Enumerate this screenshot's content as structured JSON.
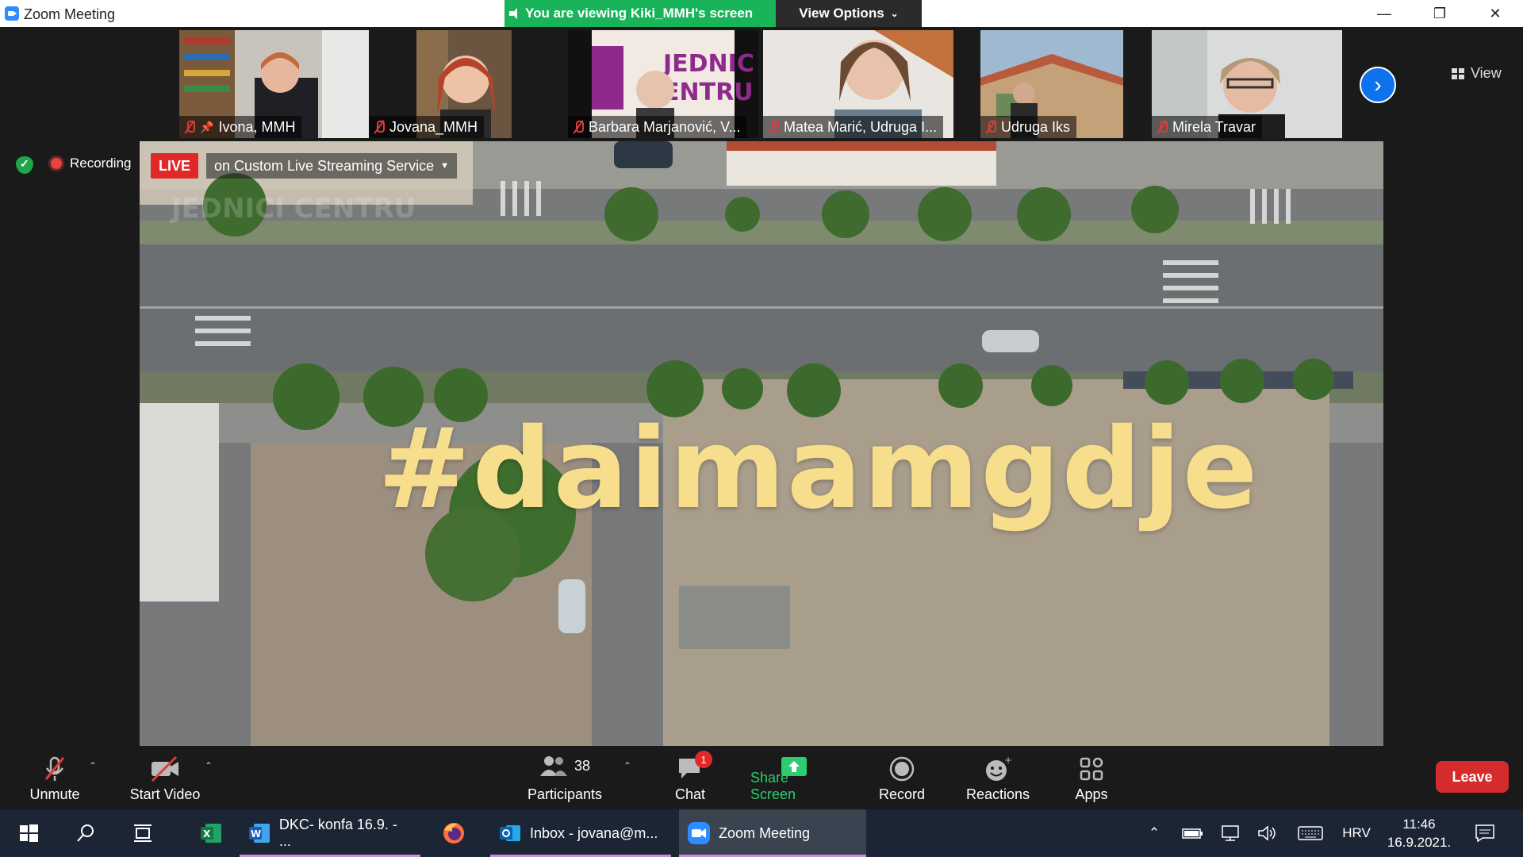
{
  "window": {
    "title": "Zoom Meeting",
    "viewing_banner": "You are viewing Kiki_MMH's screen",
    "view_options": "View Options",
    "view_label": "View"
  },
  "participants_strip": [
    {
      "name": "Ivona, MMH",
      "muted": true,
      "pinned": true,
      "active": true
    },
    {
      "name": "Jovana_MMH",
      "muted": true
    },
    {
      "name": "Barbara Marjanović, V...",
      "muted": true
    },
    {
      "name": "Matea Marić, Udruga I...",
      "muted": true
    },
    {
      "name": "Udruga Iks",
      "muted": true
    },
    {
      "name": "Mirela Travar",
      "muted": true
    }
  ],
  "status": {
    "recording": "Recording",
    "live": "LIVE",
    "streaming": "on Custom Live Streaming Service"
  },
  "shared_screen": {
    "hashtag": "#daimamgdje",
    "watermark": "JEDNICI CENTRU"
  },
  "toolbar": {
    "unmute": "Unmute",
    "start_video": "Start Video",
    "participants": "Participants",
    "participants_count": "38",
    "chat": "Chat",
    "chat_badge": "1",
    "share_screen": "Share Screen",
    "record": "Record",
    "reactions": "Reactions",
    "apps": "Apps",
    "leave": "Leave"
  },
  "taskbar": {
    "word": "DKC- konfa 16.9. - ...",
    "outlook": "Inbox - jovana@m...",
    "zoom": "Zoom Meeting",
    "language": "HRV",
    "time": "11:46",
    "date": "16.9.2021."
  },
  "colors": {
    "accent_green": "#19b35a",
    "live_red": "#e02828",
    "leave_red": "#d42c2c",
    "zoom_blue": "#0e72ed",
    "hashtag_yellow": "#f7de8c"
  }
}
